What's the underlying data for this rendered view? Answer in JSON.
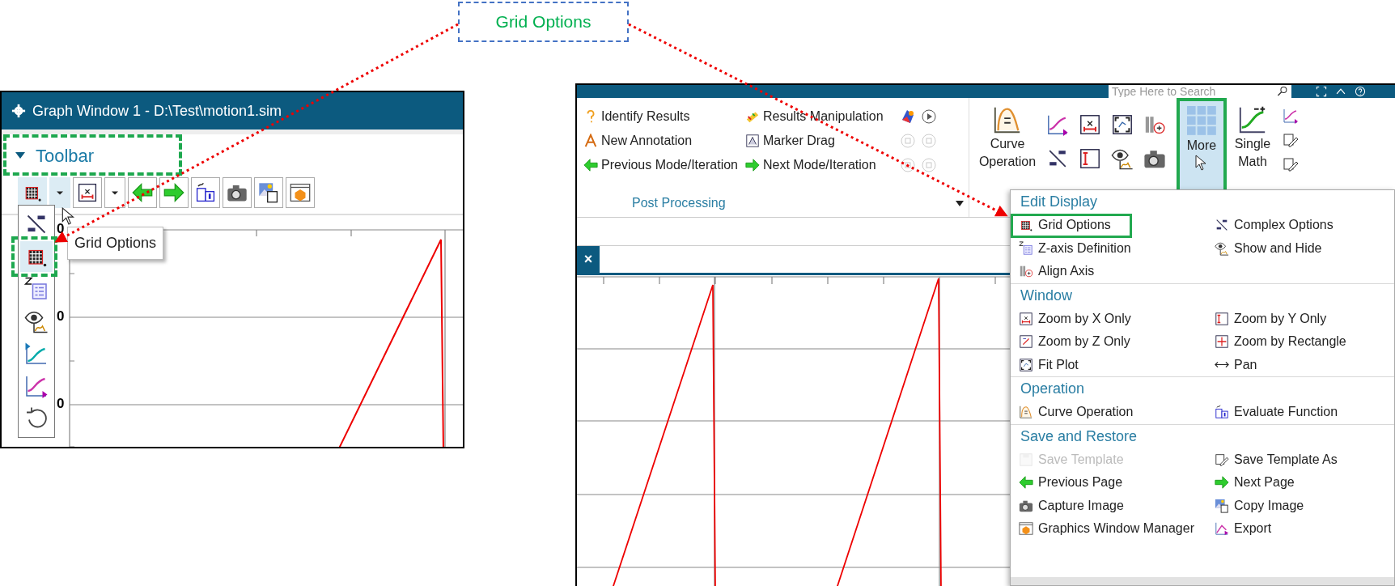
{
  "callout": {
    "label": "Grid Options"
  },
  "graph_window": {
    "title": "Graph Window 1 - D:\\Test\\motion1.sim",
    "toolbar_header": {
      "label": "Toolbar",
      "expanded": true,
      "highlighted": true
    },
    "toolbar_buttons": [
      {
        "active": true
      },
      {
        "active": false
      },
      {
        "active": false
      },
      {
        "active": false
      },
      {
        "active": false
      },
      {
        "active": false
      },
      {
        "active": false
      },
      {
        "active": false
      }
    ],
    "dropdown_items": [
      {
        "active": false,
        "highlighted": false
      },
      {
        "active": true,
        "highlighted": true
      },
      {
        "active": false,
        "highlighted": false
      },
      {
        "active": false,
        "highlighted": false
      },
      {
        "active": false,
        "highlighted": false
      },
      {
        "active": false,
        "highlighted": false
      },
      {
        "active": false,
        "highlighted": false
      }
    ],
    "tooltip": "Grid Options",
    "y_tick_labels": [
      "0",
      "0",
      "0"
    ]
  },
  "main_window": {
    "search": {
      "placeholder": "Type Here to Search"
    },
    "ribbon": {
      "rows": [
        {
          "left": "Identify Results",
          "right": "Results Manipulation",
          "buttons": [
            {
              "disabled": false
            }
          ]
        },
        {
          "left": "New Annotation",
          "right": "Marker Drag",
          "buttons": [
            {
              "disabled": true
            },
            {
              "disabled": true
            }
          ]
        },
        {
          "left": "Previous Mode/Iteration",
          "right": "Next Mode/Iteration",
          "buttons": [
            {
              "disabled": true
            },
            {
              "disabled": true
            }
          ]
        }
      ],
      "group_label": "Post Processing",
      "big_buttons": [
        {
          "label": "Curve Operation",
          "active": false,
          "highlighted": false
        },
        {
          "label": "More",
          "active": true,
          "highlighted": true
        },
        {
          "label": "Single Math",
          "active": false,
          "highlighted": false
        }
      ]
    },
    "tab_close": "×",
    "menu": {
      "sections": [
        {
          "title": "Edit Display",
          "items": [
            {
              "label": "Grid Options",
              "disabled": false,
              "highlighted": true
            },
            {
              "label": "Complex Options",
              "disabled": false,
              "highlighted": false
            },
            {
              "label": "Z-axis Definition",
              "disabled": false,
              "highlighted": false
            },
            {
              "label": "Show and Hide",
              "disabled": false,
              "highlighted": false
            },
            {
              "label": "Align Axis",
              "disabled": false,
              "highlighted": false
            }
          ]
        },
        {
          "title": "Window",
          "items": [
            {
              "label": "Zoom by X Only",
              "disabled": false,
              "highlighted": false
            },
            {
              "label": "Zoom by Y Only",
              "disabled": false,
              "highlighted": false
            },
            {
              "label": "Zoom by Z Only",
              "disabled": false,
              "highlighted": false
            },
            {
              "label": "Zoom by Rectangle",
              "disabled": false,
              "highlighted": false
            },
            {
              "label": "Fit Plot",
              "disabled": false,
              "highlighted": false
            },
            {
              "label": "Pan",
              "disabled": false,
              "highlighted": false
            }
          ]
        },
        {
          "title": "Operation",
          "items": [
            {
              "label": "Curve Operation",
              "disabled": false,
              "highlighted": false
            },
            {
              "label": "Evaluate Function",
              "disabled": false,
              "highlighted": false
            }
          ]
        },
        {
          "title": "Save and Restore",
          "items": [
            {
              "label": "Save Template",
              "disabled": true,
              "highlighted": false
            },
            {
              "label": "Save Template As",
              "disabled": false,
              "highlighted": false
            },
            {
              "label": "Previous Page",
              "disabled": false,
              "highlighted": false
            },
            {
              "label": "Next Page",
              "disabled": false,
              "highlighted": false
            },
            {
              "label": "Capture Image",
              "disabled": false,
              "highlighted": false
            },
            {
              "label": "Copy Image",
              "disabled": false,
              "highlighted": false
            },
            {
              "label": "Graphics Window Manager",
              "disabled": false,
              "highlighted": false
            },
            {
              "label": "Export",
              "disabled": false,
              "highlighted": false
            }
          ]
        }
      ]
    }
  }
}
